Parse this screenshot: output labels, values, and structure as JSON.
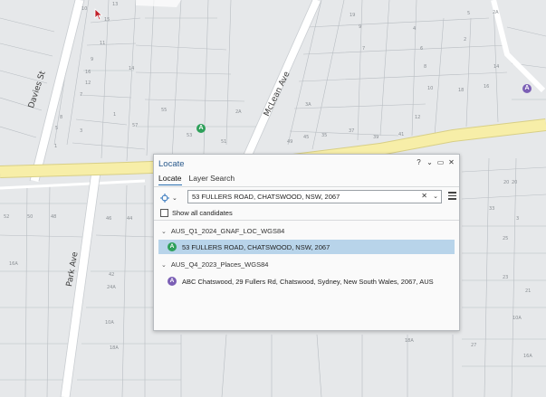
{
  "map": {
    "streets": [
      "Davies St",
      "McLean Ave",
      "Park Ave"
    ],
    "parcel_labels": [
      "10",
      "15",
      "13",
      "11",
      "14",
      "1",
      "9",
      "16",
      "12",
      "7",
      "8",
      "5",
      "3",
      "1",
      "57",
      "55",
      "53",
      "51",
      "49",
      "3A",
      "2A",
      "45",
      "35",
      "37",
      "39",
      "41",
      "19",
      "9",
      "7",
      "5",
      "2",
      "2A",
      "4",
      "6",
      "8",
      "10",
      "12",
      "14",
      "16",
      "18",
      "20",
      "20",
      "33",
      "25",
      "3",
      "21",
      "23",
      "27",
      "29",
      "31",
      "49",
      "5",
      "24",
      "26",
      "28",
      "17",
      "15",
      "13",
      "11",
      "23",
      "25",
      "27",
      "29",
      "31",
      "47",
      "43",
      "41",
      "39",
      "37",
      "31",
      "30",
      "32",
      "34",
      "36",
      "38",
      "40",
      "42",
      "44",
      "35",
      "33",
      "31",
      "29",
      "66",
      "64",
      "62",
      "60",
      "58",
      "54",
      "52",
      "50",
      "48",
      "46",
      "44",
      "42",
      "24A",
      "10A",
      "18A",
      "16A"
    ],
    "pins": [
      {
        "letter": "A",
        "color": "#2ea05a"
      },
      {
        "letter": "A",
        "color": "#7b5fb5"
      }
    ],
    "colors": {
      "background": "#e6e8ea",
      "main_road": "#f7eea8",
      "road": "#ffffff",
      "parcel_line": "#b8bdc2"
    }
  },
  "locate_pane": {
    "title": "Locate",
    "controls": [
      "?",
      "⌄",
      "▭",
      "✕"
    ],
    "tabs": [
      {
        "label": "Locate",
        "active": true
      },
      {
        "label": "Layer Search",
        "active": false
      }
    ],
    "search_value": "53 FULLERS ROAD, CHATSWOOD, NSW, 2067",
    "show_all_candidates_label": "Show all candidates",
    "groups": [
      {
        "name": "AUS_Q1_2024_GNAF_LOC_WGS84",
        "results": [
          {
            "badge": "A",
            "badge_color": "#2ea05a",
            "text": "53 FULLERS ROAD, CHATSWOOD, NSW, 2067",
            "selected": true
          }
        ]
      },
      {
        "name": "AUS_Q4_2023_Places_WGS84",
        "results": [
          {
            "badge": "A",
            "badge_color": "#7b5fb5",
            "text": "ABC Chatswood, 29 Fullers Rd, Chatswood, Sydney, New South Wales, 2067, AUS",
            "selected": false
          }
        ]
      }
    ],
    "accent": "#2a6fb0"
  }
}
